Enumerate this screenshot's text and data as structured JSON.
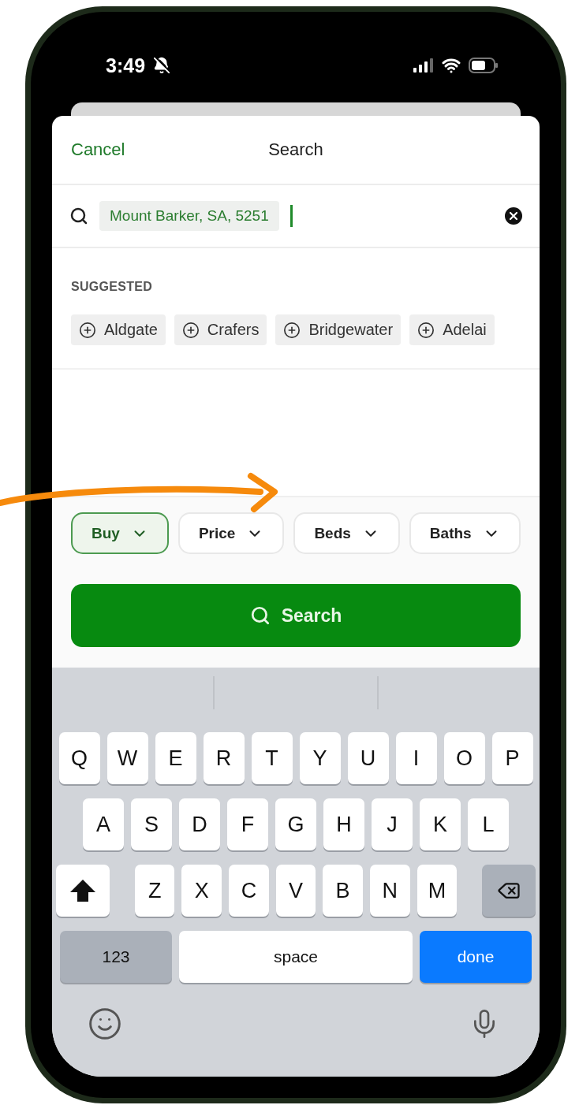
{
  "status_bar": {
    "time": "3:49"
  },
  "header": {
    "cancel": "Cancel",
    "title": "Search"
  },
  "search": {
    "value": "Mount Barker, SA, 5251"
  },
  "suggested": {
    "label": "SUGGESTED",
    "items": [
      "Aldgate",
      "Crafers",
      "Bridgewater",
      "Adelai"
    ]
  },
  "filters": [
    {
      "label": "Buy",
      "selected": true
    },
    {
      "label": "Price",
      "selected": false
    },
    {
      "label": "Beds",
      "selected": false
    },
    {
      "label": "Baths",
      "selected": false
    }
  ],
  "search_button": "Search",
  "keyboard": {
    "rows": [
      [
        "Q",
        "W",
        "E",
        "R",
        "T",
        "Y",
        "U",
        "I",
        "O",
        "P"
      ],
      [
        "A",
        "S",
        "D",
        "F",
        "G",
        "H",
        "J",
        "K",
        "L"
      ],
      [
        "Z",
        "X",
        "C",
        "V",
        "B",
        "N",
        "M"
      ]
    ],
    "numbers": "123",
    "space": "space",
    "done": "done"
  }
}
